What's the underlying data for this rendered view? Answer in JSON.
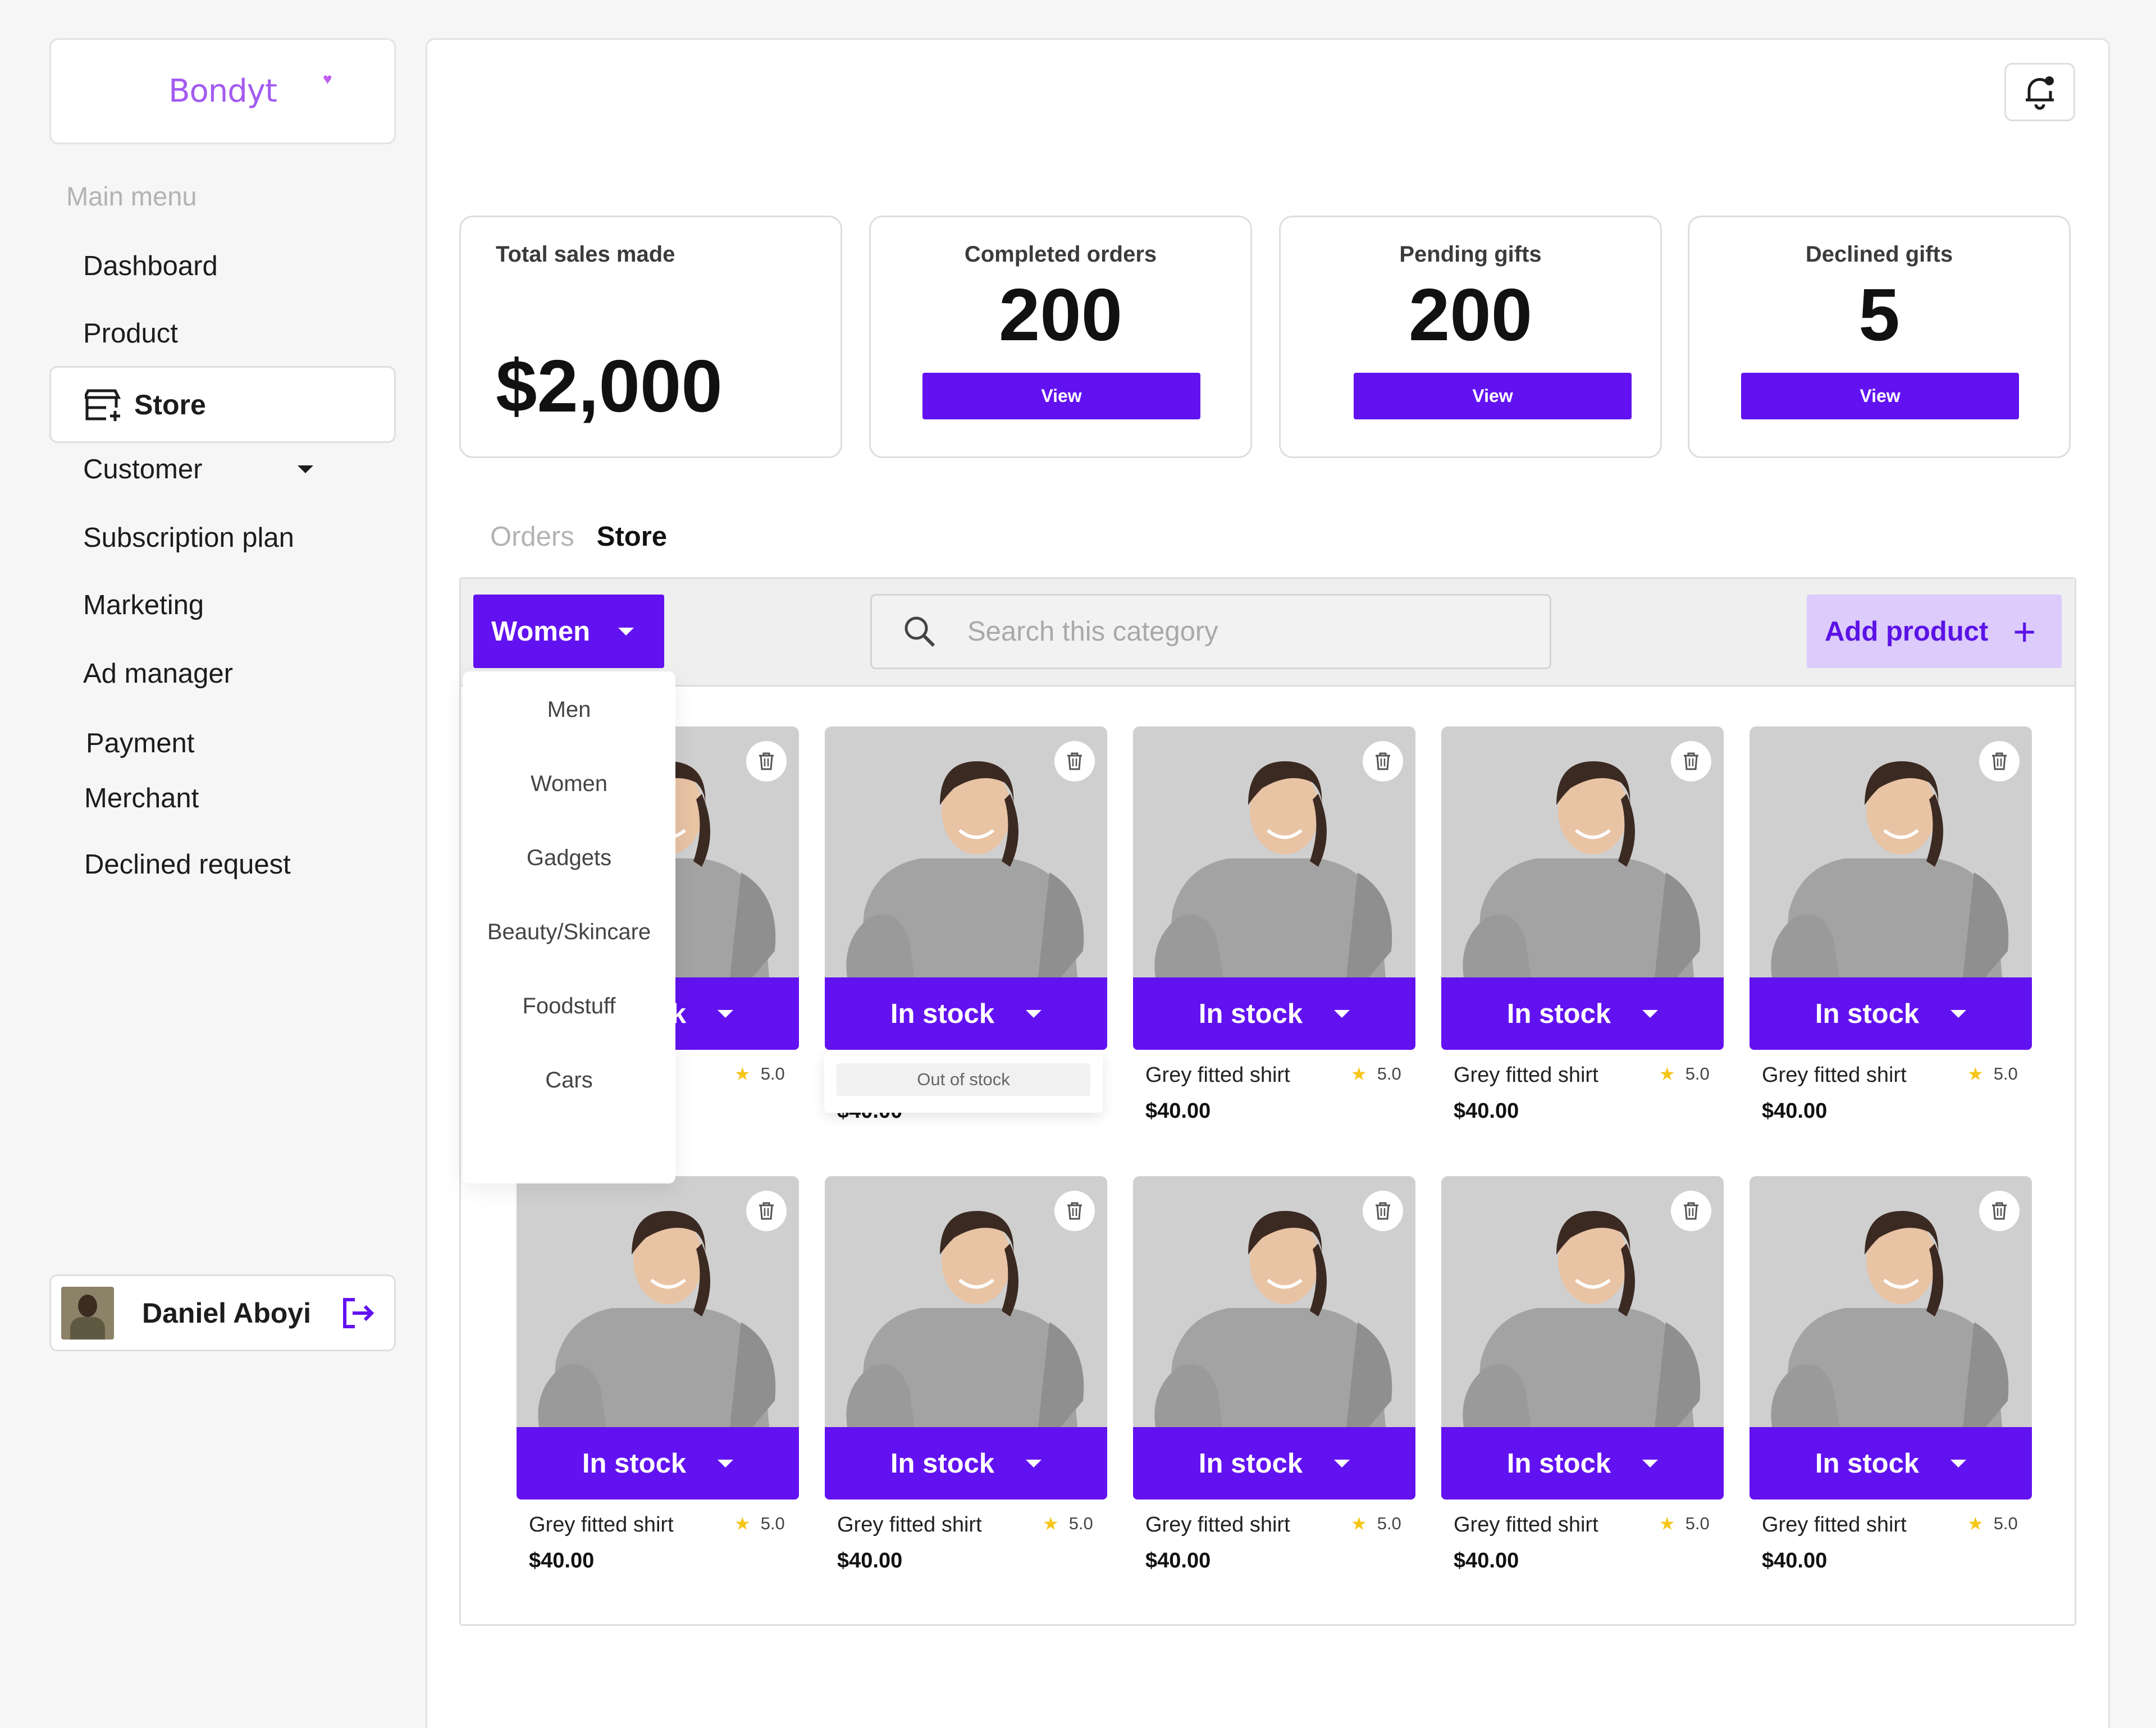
{
  "brand": {
    "logo_text": "Bondyt"
  },
  "sidebar": {
    "title": "Main menu",
    "items": [
      {
        "label": "Dashboard"
      },
      {
        "label": "Product"
      },
      {
        "label": "Store",
        "active": true
      },
      {
        "label": "Customer",
        "has_caret": true
      },
      {
        "label": "Subscription plan"
      },
      {
        "label": "Marketing"
      },
      {
        "label": "Ad manager"
      },
      {
        "label": "Payment"
      },
      {
        "label": "Merchant"
      },
      {
        "label": "Declined request"
      }
    ],
    "user": {
      "name": "Daniel Aboyi"
    }
  },
  "stats": [
    {
      "label": "Total sales made",
      "value": "$2,000"
    },
    {
      "label": "Completed  orders",
      "value": "200",
      "button": "View"
    },
    {
      "label": "Pending gifts",
      "value": "200",
      "button": "View"
    },
    {
      "label": "Declined gifts",
      "value": "5",
      "button": "View"
    }
  ],
  "tabs": {
    "orders": "Orders",
    "store": "Store"
  },
  "toolbar": {
    "category_selected": "Women",
    "search_placeholder": "Search this category",
    "add_product": "Add product"
  },
  "category_menu": [
    "Men",
    "Women",
    "Gadgets",
    "Beauty/Skincare",
    "Foodstuff",
    "Cars"
  ],
  "stock_menu": {
    "option": "Out of stock"
  },
  "products": {
    "stock_label": "In stock",
    "name": "Grey fitted shirt",
    "rating": "5.0",
    "price": "$40.00"
  },
  "colors": {
    "accent": "#6212f0",
    "accent_light": "#dccbfb",
    "brand": "#a35af0",
    "star": "#f5c518"
  },
  "icons": [
    "store-icon",
    "bell-icon",
    "logout-icon",
    "search-icon",
    "trash-icon",
    "star-icon",
    "plus-icon",
    "caret-down-icon"
  ]
}
